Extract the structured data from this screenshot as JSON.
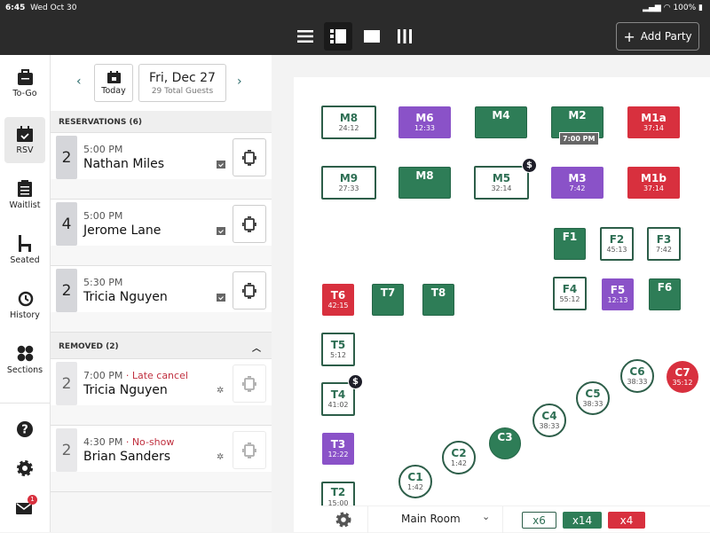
{
  "status_bar": {
    "time": "6:45",
    "date": "Wed Oct 30",
    "battery": "100%"
  },
  "toolbar": {
    "views": [
      {
        "icon": "list-icon"
      },
      {
        "icon": "split-view-icon",
        "selected": true
      },
      {
        "icon": "square-view-icon"
      },
      {
        "icon": "columns-icon"
      }
    ],
    "add_party_label": "Add Party"
  },
  "nav": {
    "items": [
      {
        "label": "To-Go",
        "icon": "bag-icon"
      },
      {
        "label": "RSV",
        "icon": "calendar-check-icon",
        "selected": true
      },
      {
        "label": "Waitlist",
        "icon": "clipboard-icon"
      },
      {
        "label": "Seated",
        "icon": "chair-icon"
      },
      {
        "label": "History",
        "icon": "history-icon"
      },
      {
        "label": "Sections",
        "icon": "sections-icon"
      }
    ],
    "bottom": [
      {
        "icon": "help-icon"
      },
      {
        "icon": "gear-icon"
      },
      {
        "icon": "mail-icon",
        "badge": "1"
      }
    ]
  },
  "date_nav": {
    "today_label": "Today",
    "date": "Fri, Dec 27",
    "guests": "29 Total Guests"
  },
  "reservations": {
    "header": "RESERVATIONS (6)",
    "items": [
      {
        "size": "2",
        "time": "5:00 PM",
        "name": "Nathan Miles"
      },
      {
        "size": "4",
        "time": "5:00 PM",
        "name": "Jerome Lane"
      },
      {
        "size": "2",
        "time": "5:30 PM",
        "name": "Tricia Nguyen"
      }
    ]
  },
  "removed": {
    "header": "REMOVED (2)",
    "items": [
      {
        "size": "2",
        "time": "7:00 PM",
        "note": "· Late cancel",
        "name": "Tricia Nguyen"
      },
      {
        "size": "2",
        "time": "4:30 PM",
        "note": "· No-show",
        "name": "Brian Sanders"
      }
    ]
  },
  "colors": {
    "green": "#2e7d57",
    "purple": "#8a52c8",
    "red": "#d8303e",
    "open": "#ffffff"
  },
  "tables": [
    {
      "name": "M8",
      "timer": "24:12",
      "status": "open"
    },
    {
      "name": "M6",
      "timer": "12:33",
      "status": "purple"
    },
    {
      "name": "M4",
      "timer": "",
      "status": "green"
    },
    {
      "name": "M2",
      "timer": "",
      "status": "green",
      "badge": "7:00 PM"
    },
    {
      "name": "M1a",
      "timer": "37:14",
      "status": "red"
    },
    {
      "name": "M9",
      "timer": "27:33",
      "status": "open"
    },
    {
      "name": "M8",
      "timer": "",
      "status": "green"
    },
    {
      "name": "M5",
      "timer": "32:14",
      "status": "open",
      "dollar": "$"
    },
    {
      "name": "M3",
      "timer": "7:42",
      "status": "purple"
    },
    {
      "name": "M1b",
      "timer": "37:14",
      "status": "red"
    },
    {
      "name": "F1",
      "timer": "",
      "status": "green"
    },
    {
      "name": "F2",
      "timer": "45:13",
      "status": "open"
    },
    {
      "name": "F3",
      "timer": "7:42",
      "status": "open"
    },
    {
      "name": "F4",
      "timer": "55:12",
      "status": "open"
    },
    {
      "name": "F5",
      "timer": "12:13",
      "status": "purple"
    },
    {
      "name": "F6",
      "timer": "",
      "status": "green"
    },
    {
      "name": "T6",
      "timer": "42:15",
      "status": "red"
    },
    {
      "name": "T7",
      "timer": "",
      "status": "green"
    },
    {
      "name": "T8",
      "timer": "",
      "status": "green"
    },
    {
      "name": "T5",
      "timer": "5:12",
      "status": "open"
    },
    {
      "name": "T4",
      "timer": "41:02",
      "status": "open",
      "dollar": "$"
    },
    {
      "name": "T3",
      "timer": "12:22",
      "status": "purple"
    },
    {
      "name": "T2",
      "timer": "15:00",
      "status": "open"
    },
    {
      "name": "C1",
      "timer": "1:42",
      "status": "open",
      "shape": "circle"
    },
    {
      "name": "C2",
      "timer": "1:42",
      "status": "open",
      "shape": "circle"
    },
    {
      "name": "C3",
      "timer": "",
      "status": "green",
      "shape": "circle"
    },
    {
      "name": "C4",
      "timer": "38:33",
      "status": "open",
      "shape": "circle"
    },
    {
      "name": "C5",
      "timer": "38:33",
      "status": "open",
      "shape": "circle"
    },
    {
      "name": "C6",
      "timer": "38:33",
      "status": "open",
      "shape": "circle"
    },
    {
      "name": "C7",
      "timer": "35:12",
      "status": "red",
      "shape": "circle"
    }
  ],
  "bottom_bar": {
    "room": "Main Room",
    "counts": [
      {
        "label": "x6",
        "status": "open"
      },
      {
        "label": "x14",
        "status": "green"
      },
      {
        "label": "x4",
        "status": "red"
      }
    ]
  }
}
